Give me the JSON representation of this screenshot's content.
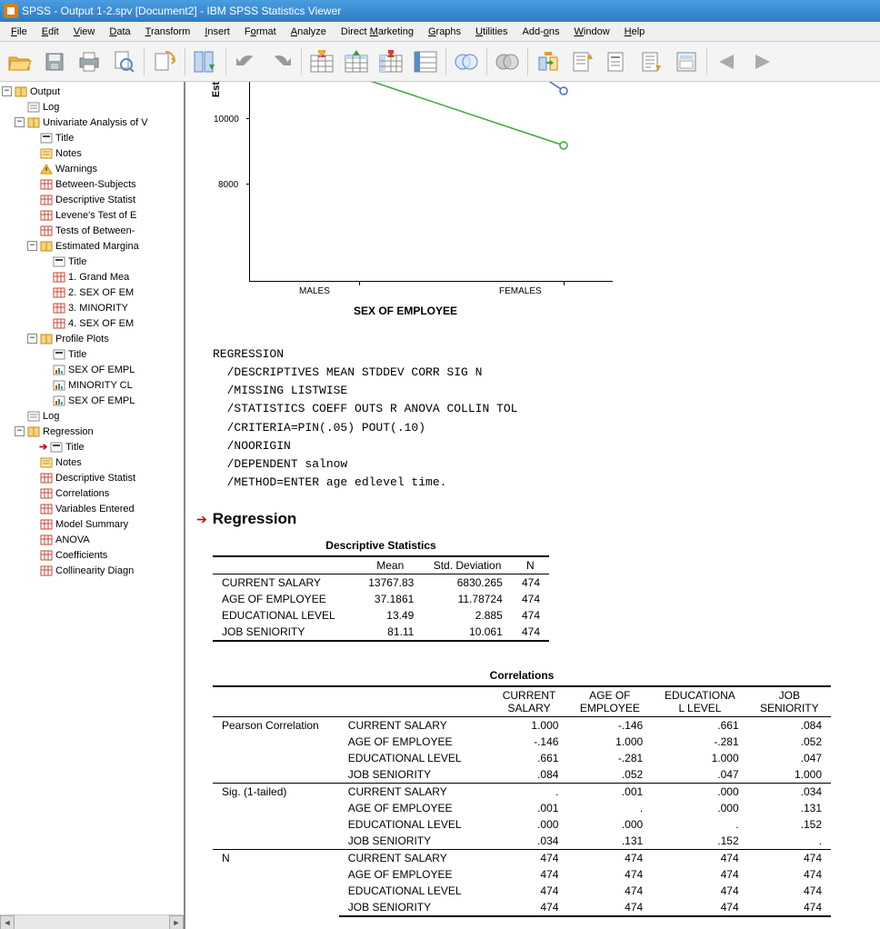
{
  "window": {
    "title": "SPSS - Output 1-2.spv [Document2] - IBM SPSS Statistics Viewer"
  },
  "menu": {
    "items": [
      "File",
      "Edit",
      "View",
      "Data",
      "Transform",
      "Insert",
      "Format",
      "Analyze",
      "Direct Marketing",
      "Graphs",
      "Utilities",
      "Add-ons",
      "Window",
      "Help"
    ]
  },
  "outline": {
    "root": "Output",
    "items": [
      {
        "label": "Output",
        "indent": 0,
        "exp": "-",
        "icon": "book"
      },
      {
        "label": "Log",
        "indent": 1,
        "icon": "log"
      },
      {
        "label": "Univariate Analysis of V",
        "indent": 1,
        "exp": "-",
        "icon": "book"
      },
      {
        "label": "Title",
        "indent": 2,
        "icon": "title"
      },
      {
        "label": "Notes",
        "indent": 2,
        "icon": "notes"
      },
      {
        "label": "Warnings",
        "indent": 2,
        "icon": "warn"
      },
      {
        "label": "Between-Subjects",
        "indent": 2,
        "icon": "table"
      },
      {
        "label": "Descriptive Statist",
        "indent": 2,
        "icon": "table"
      },
      {
        "label": "Levene's Test of E",
        "indent": 2,
        "icon": "table"
      },
      {
        "label": "Tests of Between-",
        "indent": 2,
        "icon": "table"
      },
      {
        "label": "Estimated Margina",
        "indent": 2,
        "exp": "-",
        "icon": "book"
      },
      {
        "label": "Title",
        "indent": 3,
        "icon": "title"
      },
      {
        "label": "1. Grand Mea",
        "indent": 3,
        "icon": "table"
      },
      {
        "label": "2. SEX OF EM",
        "indent": 3,
        "icon": "table"
      },
      {
        "label": "3. MINORITY",
        "indent": 3,
        "icon": "table"
      },
      {
        "label": "4. SEX OF EM",
        "indent": 3,
        "icon": "table"
      },
      {
        "label": "Profile Plots",
        "indent": 2,
        "exp": "-",
        "icon": "book"
      },
      {
        "label": "Title",
        "indent": 3,
        "icon": "title"
      },
      {
        "label": "SEX OF EMPL",
        "indent": 3,
        "icon": "chart"
      },
      {
        "label": "MINORITY CL",
        "indent": 3,
        "icon": "chart"
      },
      {
        "label": "SEX OF EMPL",
        "indent": 3,
        "icon": "chart"
      },
      {
        "label": "Log",
        "indent": 1,
        "icon": "log"
      },
      {
        "label": "Regression",
        "indent": 1,
        "exp": "-",
        "icon": "book"
      },
      {
        "label": "Title",
        "indent": 2,
        "icon": "title",
        "current": true
      },
      {
        "label": "Notes",
        "indent": 2,
        "icon": "notes"
      },
      {
        "label": "Descriptive Statist",
        "indent": 2,
        "icon": "table"
      },
      {
        "label": "Correlations",
        "indent": 2,
        "icon": "table"
      },
      {
        "label": "Variables Entered",
        "indent": 2,
        "icon": "table"
      },
      {
        "label": "Model Summary",
        "indent": 2,
        "icon": "table"
      },
      {
        "label": "ANOVA",
        "indent": 2,
        "icon": "table"
      },
      {
        "label": "Coefficients",
        "indent": 2,
        "icon": "table"
      },
      {
        "label": "Collinearity Diagn",
        "indent": 2,
        "icon": "table"
      }
    ]
  },
  "chart_data": {
    "type": "line",
    "title_fragment": "Est",
    "xlabel": "SEX OF EMPLOYEE",
    "categories": [
      "MALES",
      "FEMALES"
    ],
    "y_ticks_visible": [
      10000,
      8000
    ],
    "series": [
      {
        "name": "series-blue",
        "visible_points": [
          {
            "x": "FEMALES",
            "y_est": 10800
          }
        ]
      },
      {
        "name": "series-green",
        "visible_points": [
          {
            "x": "MALES",
            "y_est": 11200
          },
          {
            "x": "FEMALES",
            "y_est": 9100
          }
        ]
      }
    ],
    "note": "Chart is partially scrolled out of view; values above are rough estimates from tick spacing."
  },
  "syntax": {
    "lines": [
      "REGRESSION",
      "  /DESCRIPTIVES MEAN STDDEV CORR SIG N",
      "  /MISSING LISTWISE",
      "  /STATISTICS COEFF OUTS R ANOVA COLLIN TOL",
      "  /CRITERIA=PIN(.05) POUT(.10)",
      "  /NOORIGIN",
      "  /DEPENDENT salnow",
      "  /METHOD=ENTER age edlevel time."
    ]
  },
  "regression": {
    "heading": "Regression",
    "desc_table": {
      "title": "Descriptive Statistics",
      "cols": [
        "Mean",
        "Std. Deviation",
        "N"
      ],
      "rows": [
        {
          "label": "CURRENT SALARY",
          "mean": "13767.83",
          "sd": "6830.265",
          "n": "474"
        },
        {
          "label": "AGE OF EMPLOYEE",
          "mean": "37.1861",
          "sd": "11.78724",
          "n": "474"
        },
        {
          "label": "EDUCATIONAL LEVEL",
          "mean": "13.49",
          "sd": "2.885",
          "n": "474"
        },
        {
          "label": "JOB SENIORITY",
          "mean": "81.11",
          "sd": "10.061",
          "n": "474"
        }
      ]
    },
    "corr_table": {
      "title": "Correlations",
      "cols": [
        "CURRENT SALARY",
        "AGE OF EMPLOYEE",
        "EDUCATIONA L LEVEL",
        "JOB SENIORITY"
      ],
      "sections": [
        {
          "label": "Pearson Correlation",
          "rows": [
            {
              "label": "CURRENT SALARY",
              "v": [
                "1.000",
                "-.146",
                ".661",
                ".084"
              ]
            },
            {
              "label": "AGE OF EMPLOYEE",
              "v": [
                "-.146",
                "1.000",
                "-.281",
                ".052"
              ]
            },
            {
              "label": "EDUCATIONAL LEVEL",
              "v": [
                ".661",
                "-.281",
                "1.000",
                ".047"
              ]
            },
            {
              "label": "JOB SENIORITY",
              "v": [
                ".084",
                ".052",
                ".047",
                "1.000"
              ]
            }
          ]
        },
        {
          "label": "Sig. (1-tailed)",
          "rows": [
            {
              "label": "CURRENT SALARY",
              "v": [
                ".",
                ".001",
                ".000",
                ".034"
              ]
            },
            {
              "label": "AGE OF EMPLOYEE",
              "v": [
                ".001",
                ".",
                ".000",
                ".131"
              ]
            },
            {
              "label": "EDUCATIONAL LEVEL",
              "v": [
                ".000",
                ".000",
                ".",
                ".152"
              ]
            },
            {
              "label": "JOB SENIORITY",
              "v": [
                ".034",
                ".131",
                ".152",
                "."
              ]
            }
          ]
        },
        {
          "label": "N",
          "rows": [
            {
              "label": "CURRENT SALARY",
              "v": [
                "474",
                "474",
                "474",
                "474"
              ]
            },
            {
              "label": "AGE OF EMPLOYEE",
              "v": [
                "474",
                "474",
                "474",
                "474"
              ]
            },
            {
              "label": "EDUCATIONAL LEVEL",
              "v": [
                "474",
                "474",
                "474",
                "474"
              ]
            },
            {
              "label": "JOB SENIORITY",
              "v": [
                "474",
                "474",
                "474",
                "474"
              ]
            }
          ]
        }
      ]
    }
  }
}
